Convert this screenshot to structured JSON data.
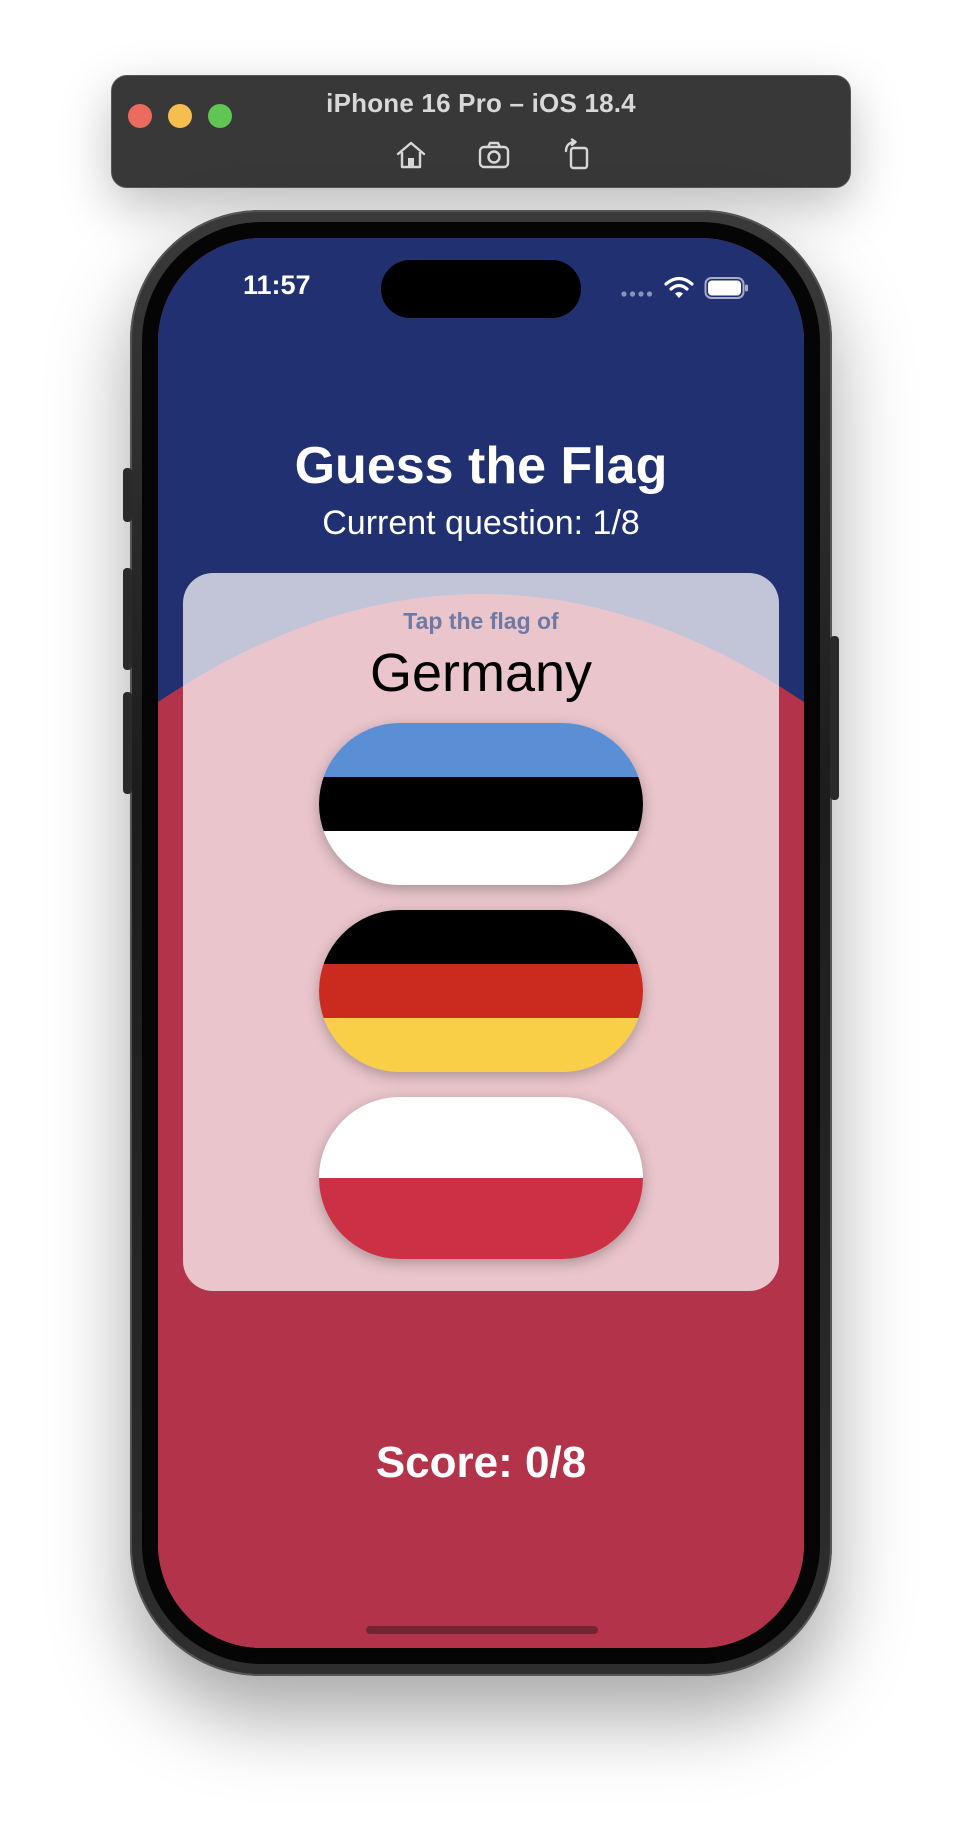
{
  "simulator": {
    "title": "iPhone 16 Pro – iOS 18.4",
    "toolbar_icons": [
      "home-icon",
      "screenshot-icon",
      "rotate-icon"
    ]
  },
  "status_bar": {
    "time": "11:57"
  },
  "app": {
    "title": "Guess the Flag",
    "question_counter": "Current question: 1/8",
    "prompt_label": "Tap the flag of",
    "target_country": "Germany",
    "score": "Score: 0/8",
    "flags": [
      {
        "stripes": [
          "#5a8fd6",
          "#000000",
          "#ffffff"
        ]
      },
      {
        "stripes": [
          "#000000",
          "#cb2b1f",
          "#f8cf47"
        ]
      },
      {
        "stripes": [
          "#ffffff",
          "#cc3044"
        ]
      }
    ]
  },
  "colors": {
    "background_top": "#213070",
    "background_bottom": "#b3344a",
    "card": "#ffffff"
  }
}
